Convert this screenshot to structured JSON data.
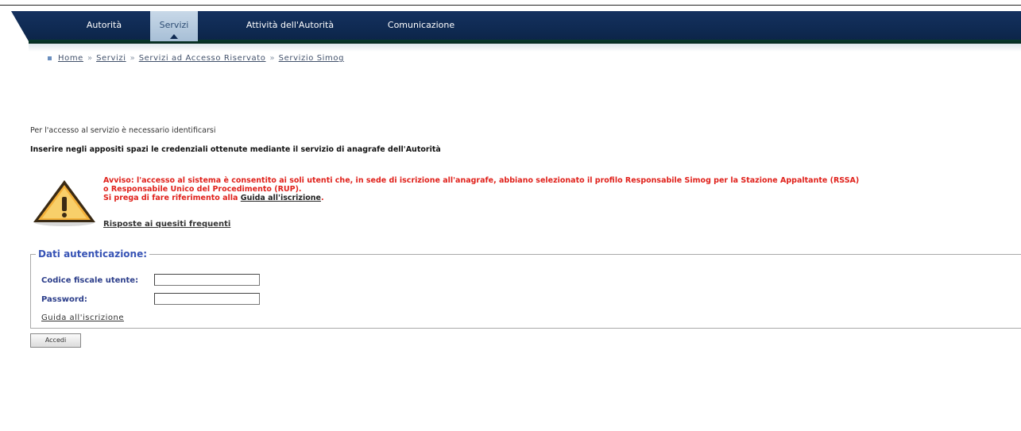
{
  "nav": {
    "items": [
      {
        "label": "Autorità"
      },
      {
        "label": "Servizi"
      },
      {
        "label": "Attività dell'Autorità"
      },
      {
        "label": "Comunicazione"
      }
    ],
    "active_index": 1
  },
  "breadcrumb": {
    "items": [
      "Home",
      "Servizi",
      "Servizi ad Accesso Riservato",
      "Servizio Simog"
    ],
    "separator": "»"
  },
  "intro": {
    "line1": "Per l'accesso al servizio è necessario identificarsi",
    "line2": "Inserire negli appositi spazi le credenziali ottenute mediante il servizio di anagrafe dell'Autorità"
  },
  "warning": {
    "icon": "warning-triangle-icon",
    "line1": "Avviso: l'accesso al sistema è consentito ai soli utenti che, in sede di iscrizione all'anagrafe, abbiano selezionato il profilo Responsabile Simog per la Stazione Appaltante (RSSA)",
    "line2": "o Responsabile Unico del Procedimento (RUP).",
    "line3_prefix": "Si prega di fare riferimento alla ",
    "line3_link": "Guida all'iscrizione",
    "line3_suffix": "."
  },
  "faq_link": "Risposte ai quesiti frequenti",
  "auth": {
    "legend": "Dati autenticazione:",
    "codice_label": "Codice fiscale utente:",
    "codice_value": "",
    "password_label": "Password:",
    "password_value": "",
    "guide_link": "Guida all'iscrizione"
  },
  "submit_label": "Accedi",
  "colors": {
    "nav_bg": "#0f2a52",
    "warning_text": "#e0211b",
    "legend_text": "#3753b5",
    "label_text": "#2b3d8a"
  }
}
